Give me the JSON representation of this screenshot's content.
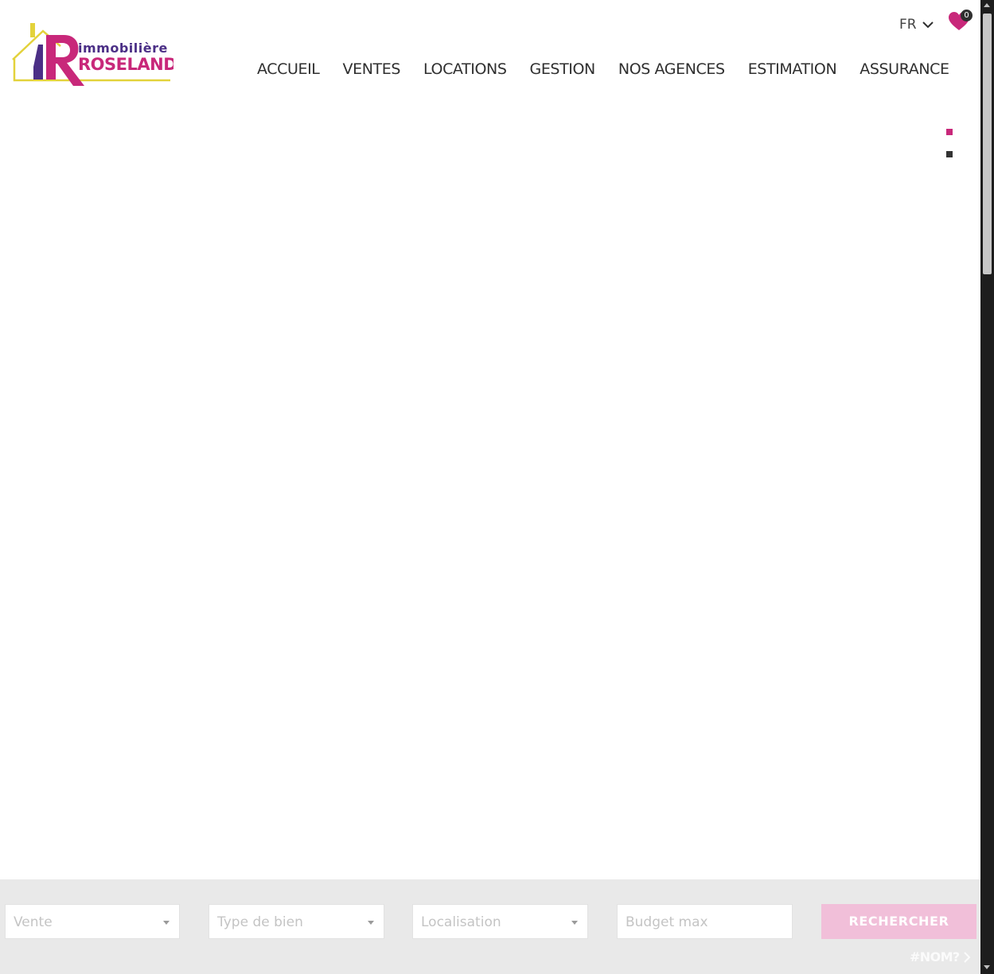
{
  "brand": {
    "logo_line1": "immobilière",
    "logo_line2": "ROSELAND",
    "primary_color": "#c8287a",
    "secondary_color": "#4b2f86",
    "accent_color": "#e3d23b"
  },
  "header": {
    "language": {
      "label": "FR",
      "icon": "chevron-down-icon"
    },
    "favorites": {
      "icon": "heart-icon",
      "count": "0"
    },
    "nav": [
      {
        "label": "ACCUEIL"
      },
      {
        "label": "VENTES"
      },
      {
        "label": "LOCATIONS"
      },
      {
        "label": "GESTION"
      },
      {
        "label": "NOS AGENCES"
      },
      {
        "label": "ESTIMATION"
      },
      {
        "label": "ASSURANCE"
      }
    ]
  },
  "slider": {
    "dots": 2,
    "active_index": 0
  },
  "search": {
    "transaction": {
      "placeholder": "Vente"
    },
    "property_type": {
      "placeholder": "Type de bien"
    },
    "location": {
      "placeholder": "Localisation"
    },
    "budget": {
      "placeholder": "Budget max"
    },
    "submit_label": "RECHERCHER",
    "reference_link": "#NOM?"
  }
}
